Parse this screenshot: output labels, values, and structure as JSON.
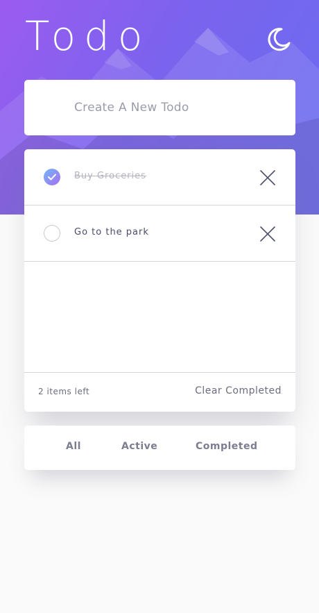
{
  "app": {
    "title": "Todo"
  },
  "new_todo": {
    "placeholder": "Create A New Todo"
  },
  "todos": [
    {
      "label": "Buy Groceries",
      "completed": true
    },
    {
      "label": "Go to the park",
      "completed": false
    }
  ],
  "footer": {
    "items_left": "2 items left",
    "clear_label": "Clear Completed"
  },
  "filters": {
    "all": "All",
    "active": "Active",
    "completed": "Completed"
  },
  "icons": {
    "theme": "moon-icon",
    "check": "check-icon",
    "delete": "cross-icon"
  },
  "colors": {
    "hero_start": "#9b5cf0",
    "hero_end": "#6a6ef0",
    "check_start": "#6fb8f8",
    "check_end": "#a86df0",
    "text": "#494c6b"
  }
}
